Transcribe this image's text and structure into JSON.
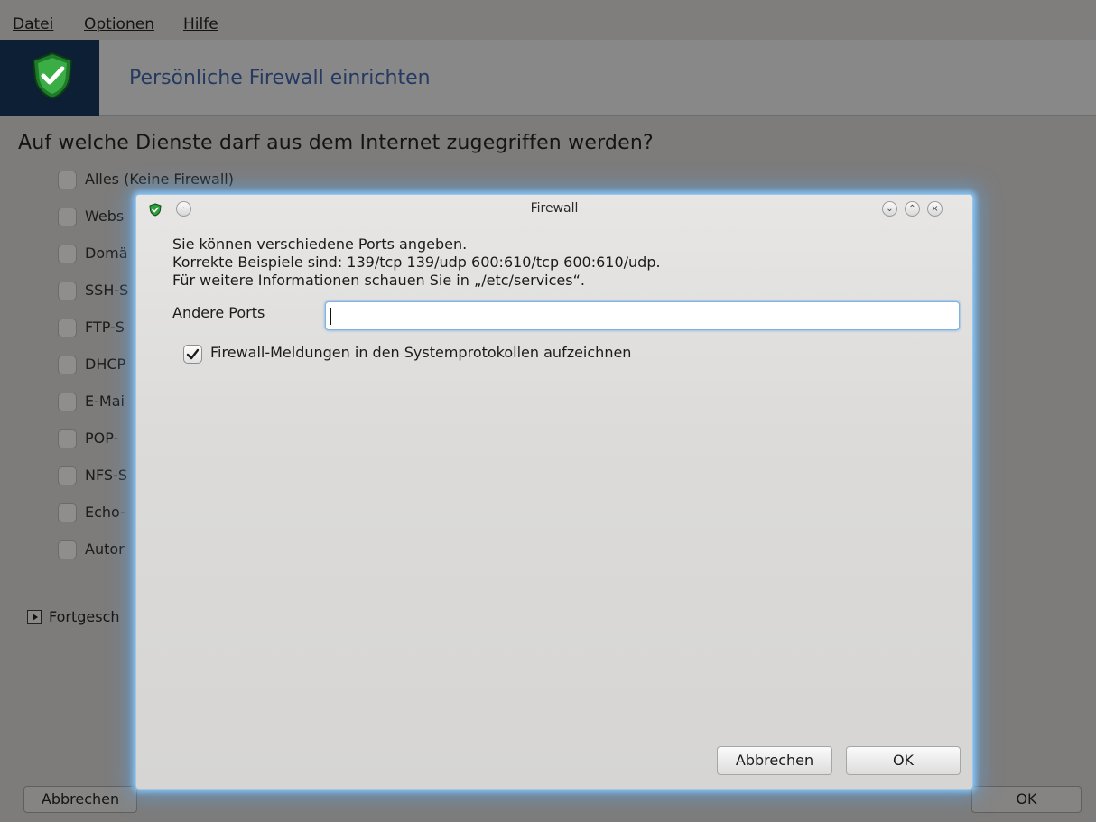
{
  "menubar": {
    "items": [
      "Datei",
      "Optionen",
      "Hilfe"
    ]
  },
  "header": {
    "title": "Persönliche Firewall einrichten",
    "icon": "shield-check-icon"
  },
  "main": {
    "question": "Auf welche Dienste darf aus dem Internet zugegriffen werden?",
    "services": [
      {
        "label": "Alles (Keine Firewall)"
      },
      {
        "label": "Webs"
      },
      {
        "label": "Domä"
      },
      {
        "label": "SSH-S"
      },
      {
        "label": "FTP-S"
      },
      {
        "label": "DHCP"
      },
      {
        "label": "E-Mai"
      },
      {
        "label": "POP-"
      },
      {
        "label": "NFS-S"
      },
      {
        "label": "Echo-"
      },
      {
        "label": "Autor"
      }
    ],
    "advanced_label": "Fortgesch",
    "cancel_label": "Abbrechen",
    "ok_label": "OK"
  },
  "dialog": {
    "title": "Firewall",
    "info_lines": [
      "Sie können verschiedene Ports angeben.",
      "Korrekte Beispiele sind: 139/tcp 139/udp 600:610/tcp 600:610/udp.",
      "Für weitere Informationen schauen Sie in „/etc/services“."
    ],
    "ports_label": "Andere Ports",
    "ports_value": "",
    "log_label": "Firewall-Meldungen in den Systemprotokollen aufzeichnen",
    "log_checked": true,
    "cancel_label": "Abbrechen",
    "ok_label": "OK"
  },
  "colors": {
    "accent": "#243a63",
    "shield": "#2e9e3a",
    "dialog_glow": "#5aaaf0"
  }
}
